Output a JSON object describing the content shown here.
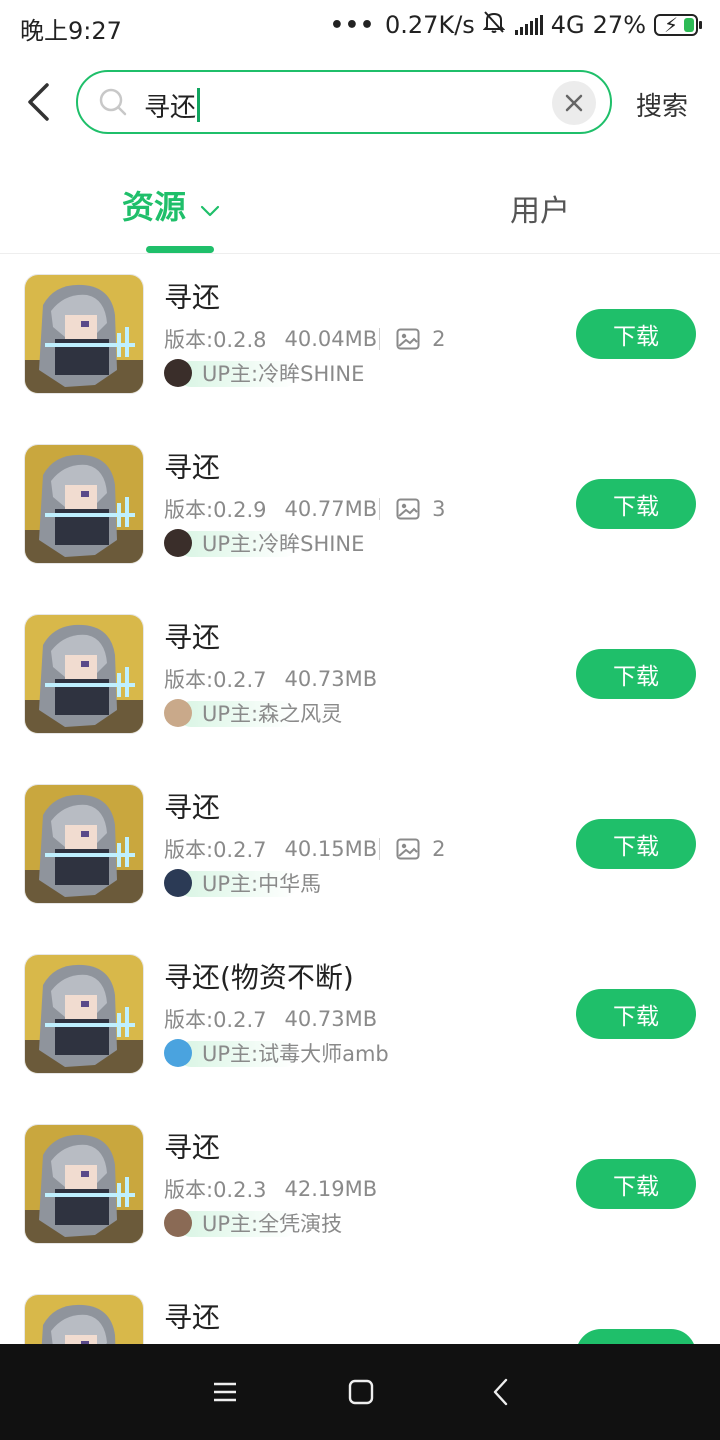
{
  "status_bar": {
    "time": "晚上9:27",
    "dots": "•••",
    "speed": "0.27K/s",
    "network": "4G",
    "battery": "27%",
    "battery_level": 0.27
  },
  "search": {
    "query": "寻还",
    "search_button": "搜索"
  },
  "tabs": [
    {
      "label": "资源",
      "active": true
    },
    {
      "label": "用户",
      "active": false
    }
  ],
  "results": [
    {
      "title": "寻还",
      "version": "版本:0.2.8",
      "size": "40.04MB",
      "image_count": "2",
      "uploader": "UP主:冷眸SHINE",
      "download_label": "下载",
      "avatar_color": "#3a2e2a"
    },
    {
      "title": "寻还",
      "version": "版本:0.2.9",
      "size": "40.77MB",
      "image_count": "3",
      "uploader": "UP主:冷眸SHINE",
      "download_label": "下载",
      "avatar_color": "#3a2e2a"
    },
    {
      "title": "寻还",
      "version": "版本:0.2.7",
      "size": "40.73MB",
      "image_count": "",
      "uploader": "UP主:森之风灵",
      "download_label": "下载",
      "avatar_color": "#c9a98a"
    },
    {
      "title": "寻还",
      "version": "版本:0.2.7",
      "size": "40.15MB",
      "image_count": "2",
      "uploader": "UP主:中华馬",
      "download_label": "下载",
      "avatar_color": "#2b3a55"
    },
    {
      "title": "寻还(物资不断)",
      "version": "版本:0.2.7",
      "size": "40.73MB",
      "image_count": "",
      "uploader": "UP主:试毒大师amb",
      "download_label": "下载",
      "avatar_color": "#4aa3df"
    },
    {
      "title": "寻还",
      "version": "版本:0.2.3",
      "size": "42.19MB",
      "image_count": "",
      "uploader": "UP主:全凭演技",
      "download_label": "下载",
      "avatar_color": "#8a6a55"
    },
    {
      "title": "寻还",
      "version": "",
      "size": "",
      "image_count": "",
      "uploader": "",
      "download_label": "",
      "avatar_color": "#cccccc"
    }
  ],
  "colors": {
    "accent": "#1fbf6a",
    "navbar": "#111111"
  }
}
